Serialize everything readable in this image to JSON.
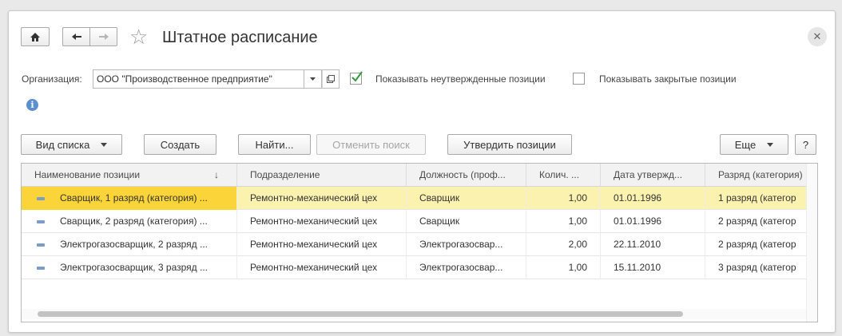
{
  "window": {
    "title": "Штатное расписание"
  },
  "filters": {
    "org_label": "Организация:",
    "org_value": "ООО \"Производственное предприятие\"",
    "show_unapproved_label": "Показывать неутвержденные позиции",
    "show_unapproved_checked": true,
    "show_closed_label": "Показывать закрытые позиции",
    "show_closed_checked": false
  },
  "toolbar": {
    "view_list_label": "Вид списка",
    "create_label": "Создать",
    "find_label": "Найти...",
    "cancel_search_label": "Отменить поиск",
    "approve_label": "Утвердить позиции",
    "more_label": "Еще",
    "help_label": "?"
  },
  "table": {
    "columns": [
      "Наименование позиции",
      "Подразделение",
      "Должность (проф...",
      "Колич. ...",
      "Дата утвержд...",
      "Разряд (категория)"
    ],
    "sort_indicator": "↓",
    "rows": [
      {
        "name": "Сварщик, 1 разряд (категория) ...",
        "dept": "Ремонтно-механический цех",
        "position": "Сварщик",
        "qty": "1,00",
        "date": "01.01.1996",
        "grade": "1 разряд (категор"
      },
      {
        "name": "Сварщик, 2 разряд (категория) ...",
        "dept": "Ремонтно-механический цех",
        "position": "Сварщик",
        "qty": "1,00",
        "date": "01.01.1996",
        "grade": "2 разряд (категор"
      },
      {
        "name": "Электрогазосварщик, 2 разряд ...",
        "dept": "Ремонтно-механический цех",
        "position": "Электрогазосвар...",
        "qty": "2,00",
        "date": "22.11.2010",
        "grade": "2 разряд (категор"
      },
      {
        "name": "Электрогазосварщик, 3 разряд ...",
        "dept": "Ремонтно-механический цех",
        "position": "Электрогазосвар...",
        "qty": "1,00",
        "date": "15.11.2010",
        "grade": "3 разряд (категор"
      }
    ]
  },
  "colors": {
    "selected_row": "#fbf2b0",
    "selected_cell": "#fbd43a",
    "checkbox_check": "#2e9a3a",
    "info_icon": "#5b8fd0"
  }
}
